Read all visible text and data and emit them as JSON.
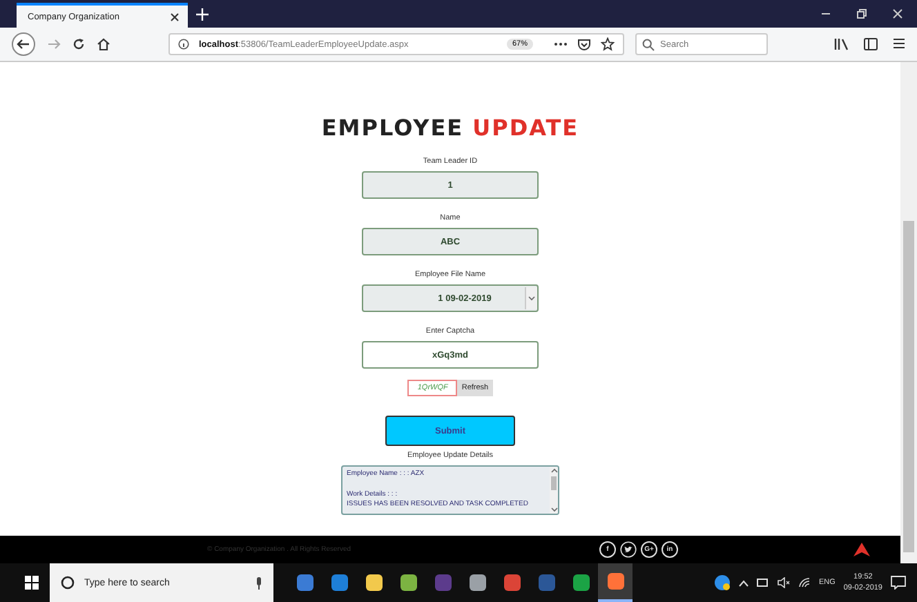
{
  "browser": {
    "tab_title": "Company Organization",
    "url_host": "localhost",
    "url_path": ":53806/TeamLeaderEmployeeUpdate.aspx",
    "zoom": "67%",
    "search_placeholder": "Search"
  },
  "page": {
    "title_first": "EMPLOYEE",
    "title_second": "UPDATE",
    "fields": [
      {
        "kind": "text",
        "label": "Team Leader ID",
        "value": "1"
      },
      {
        "kind": "text",
        "label": "Name",
        "value": "ABC"
      },
      {
        "kind": "select",
        "label": "Employee File Name",
        "value": "1 09-02-2019"
      },
      {
        "kind": "input",
        "label": "Enter Captcha",
        "value": "xGq3md"
      }
    ],
    "captcha": "1QrWQF",
    "refresh": "Refresh",
    "submit": "Submit",
    "details_label": "Employee Update Details",
    "details": "Employee Name : : : AZX\n\nWork Details : : :\nISSUES HAS BEEN RESOLVED AND TASK COMPLETED"
  },
  "footer": {
    "copyright": "© Company Organization . All Rights Reserved",
    "social": [
      {
        "kind": "letter",
        "text": "f"
      },
      {
        "kind": "bird"
      },
      {
        "kind": "letter",
        "text": "G+"
      },
      {
        "kind": "letter",
        "text": "in"
      }
    ]
  },
  "taskbar": {
    "search_placeholder": "Type here to search",
    "apps": [
      {
        "color": "#3b7bd4",
        "selected": false
      },
      {
        "color": "#1e7fd8",
        "selected": false
      },
      {
        "color": "#f2c94c",
        "selected": false
      },
      {
        "color": "#7cb342",
        "selected": false
      },
      {
        "color": "#5c3b8c",
        "selected": false
      },
      {
        "color": "#9aa0a6",
        "selected": false
      },
      {
        "color": "#db4437",
        "selected": false
      },
      {
        "color": "#2b5797",
        "selected": false
      },
      {
        "color": "#1ba345",
        "selected": false
      },
      {
        "color": "#ff7139",
        "selected": true
      }
    ],
    "language": "ENG",
    "time": "19:52",
    "date": "09-02-2019"
  }
}
